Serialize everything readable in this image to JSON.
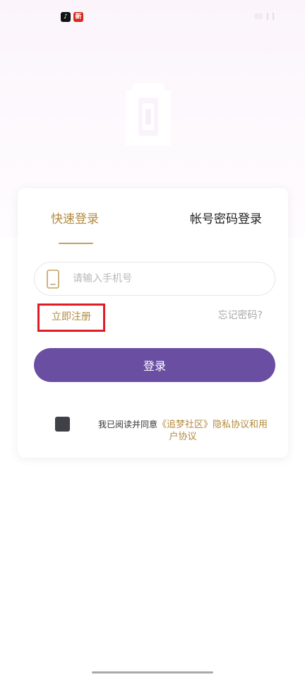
{
  "status_bar": {
    "icons": [
      "tiktok-icon",
      "red-app-icon"
    ],
    "tiktok_glyph": "♪",
    "red_app_glyph": "新"
  },
  "tabs": {
    "quick_login": "快速登录",
    "password_login": "帐号密码登录"
  },
  "phone": {
    "placeholder": "请输入手机号",
    "value": ""
  },
  "links": {
    "register": "立即注册",
    "forgot_password": "忘记密码?"
  },
  "login_button": "登录",
  "agreement": {
    "prefix": "我已阅读并同意",
    "link": "《追梦社区》隐私协议和用户协议",
    "checked": false
  },
  "colors": {
    "accent_gold": "#b38a3e",
    "primary_purple": "#6a4ea2",
    "highlight_red": "#e21c24"
  }
}
